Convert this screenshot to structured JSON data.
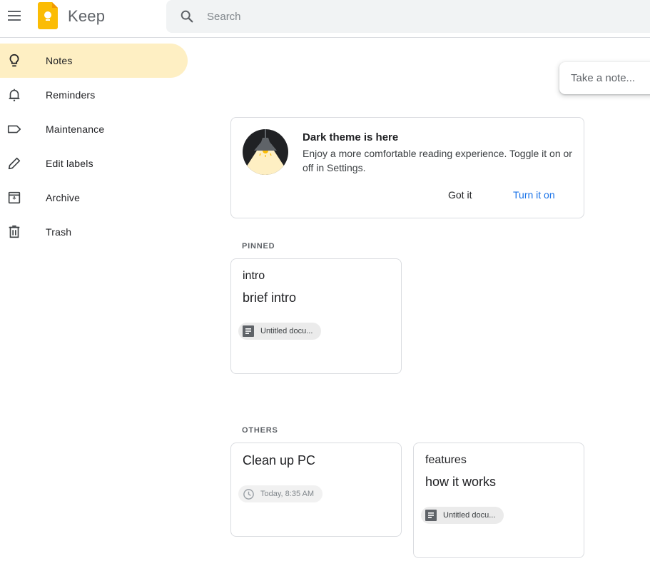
{
  "header": {
    "menu_icon": "hamburger-menu-icon",
    "logo_icon": "keep-logo-icon",
    "app_title": "Keep",
    "search": {
      "icon": "search-icon",
      "placeholder": "Search",
      "value": ""
    }
  },
  "sidebar": {
    "items": [
      {
        "label": "Notes",
        "icon": "lightbulb-icon",
        "active": true
      },
      {
        "label": "Reminders",
        "icon": "bell-icon",
        "active": false
      },
      {
        "label": "Maintenance",
        "icon": "label-icon",
        "active": false
      },
      {
        "label": "Edit labels",
        "icon": "pencil-icon",
        "active": false
      },
      {
        "label": "Archive",
        "icon": "archive-icon",
        "active": false
      },
      {
        "label": "Trash",
        "icon": "trash-icon",
        "active": false
      }
    ]
  },
  "take_note": {
    "placeholder": "Take a note..."
  },
  "promo": {
    "image": "dark-theme-lamp-icon",
    "title": "Dark theme is here",
    "body": "Enjoy a more comfortable reading experience. Toggle it on or off in Settings.",
    "dismiss_label": "Got it",
    "action_label": "Turn it on",
    "action_color": "#1a73e8"
  },
  "sections": {
    "pinned_label": "PINNED",
    "others_label": "OTHERS"
  },
  "notes": {
    "pinned": [
      {
        "title": "intro",
        "body": "brief intro",
        "attachment": {
          "icon": "google-docs-icon",
          "label": "Untitled docu..."
        }
      }
    ],
    "others": [
      {
        "title": "",
        "body": "Clean up PC",
        "reminder": {
          "icon": "clock-icon",
          "label": "Today, 8:35 AM"
        }
      },
      {
        "title": "features",
        "body": "how it works",
        "attachment": {
          "icon": "google-docs-icon",
          "label": "Untitled docu..."
        }
      }
    ]
  },
  "colors": {
    "active_nav_bg": "#feefc3",
    "logo_yellow": "#fbbc04",
    "search_bg": "#f1f3f4",
    "link_blue": "#1a73e8"
  }
}
